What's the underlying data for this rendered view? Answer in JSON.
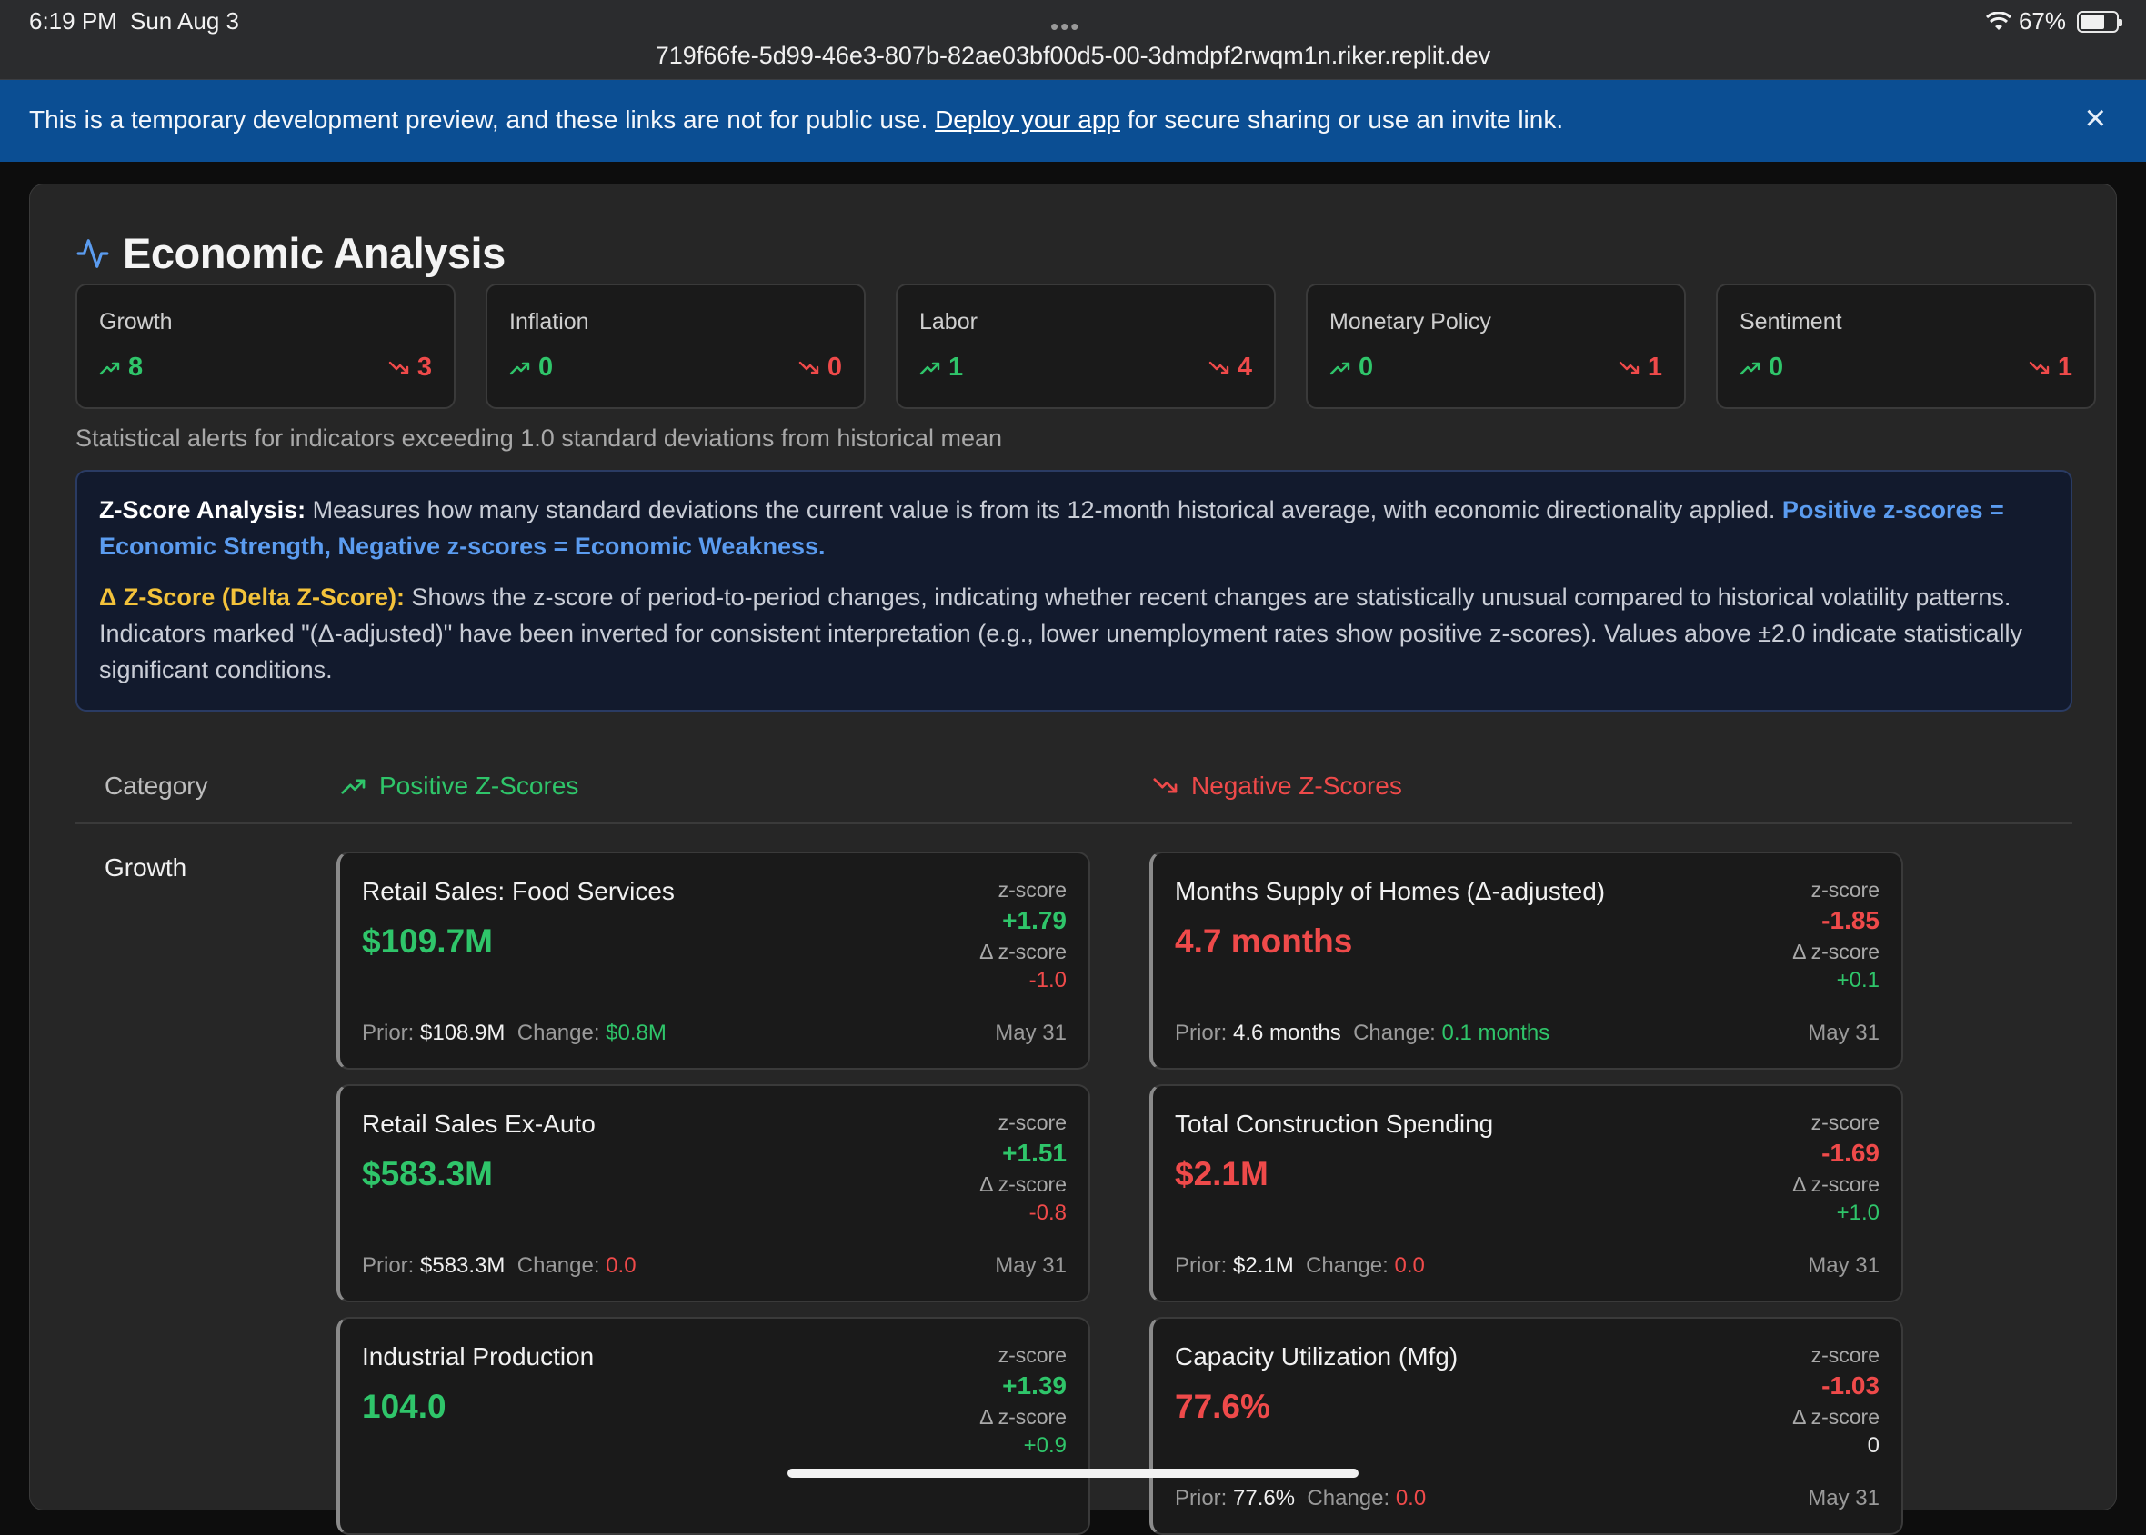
{
  "status": {
    "time": "6:19 PM",
    "date": "Sun Aug 3",
    "dots": "•••",
    "url": "719f66fe-5d99-46e3-807b-82ae03bf00d5-00-3dmdpf2rwqm1n.riker.replit.dev",
    "battery": "67%"
  },
  "banner": {
    "text_before": "This is a temporary development preview, and these links are not for public use. ",
    "link": "Deploy your app",
    "text_after": " for secure sharing or use an invite link.",
    "close": "×"
  },
  "page": {
    "title": "Economic Analysis",
    "subtitle": "Statistical alerts for indicators exceeding 1.0 standard deviations from historical mean"
  },
  "categories": [
    {
      "name": "Growth",
      "pos": "8",
      "neg": "3"
    },
    {
      "name": "Inflation",
      "pos": "0",
      "neg": "0"
    },
    {
      "name": "Labor",
      "pos": "1",
      "neg": "4"
    },
    {
      "name": "Monetary Policy",
      "pos": "0",
      "neg": "1"
    },
    {
      "name": "Sentiment",
      "pos": "0",
      "neg": "1"
    }
  ],
  "info": {
    "z_label": "Z-Score Analysis:",
    "z_text": " Measures how many standard deviations the current value is from its 12-month historical average, with economic directionality applied. ",
    "z_highlight": "Positive z-scores = Economic Strength, Negative z-scores = Economic Weakness.",
    "d_label": "Δ Z-Score (Delta Z-Score):",
    "d_text": " Shows the z-score of period-to-period changes, indicating whether recent changes are statistically unusual compared to historical volatility patterns. Indicators marked \"(Δ-adjusted)\" have been inverted for consistent interpretation (e.g., lower unemployment rates show positive z-scores). Values above ±2.0 indicate statistically significant conditions."
  },
  "table": {
    "col_category": "Category",
    "col_positive": "Positive Z-Scores",
    "col_negative": "Negative Z-Scores",
    "row_label": "Growth"
  },
  "labels": {
    "zscore": "z-score",
    "dzscore": "Δ z-score",
    "prior": "Prior: ",
    "change": "Change: "
  },
  "positive": [
    {
      "name": "Retail Sales: Food Services",
      "value": "$109.7M",
      "z": "+1.79",
      "dz": "-1.0",
      "prior": "$108.9M",
      "change": "$0.8M",
      "date": "May 31"
    },
    {
      "name": "Retail Sales Ex-Auto",
      "value": "$583.3M",
      "z": "+1.51",
      "dz": "-0.8",
      "prior": "$583.3M",
      "change": "0.0",
      "date": "May 31"
    },
    {
      "name": "Industrial Production",
      "value": "104.0",
      "z": "+1.39",
      "dz": "+0.9",
      "prior": "",
      "change": "",
      "date": ""
    }
  ],
  "negative": [
    {
      "name": "Months Supply of Homes (Δ-adjusted)",
      "value": "4.7 months",
      "z": "-1.85",
      "dz": "+0.1",
      "prior": "4.6 months",
      "change": "0.1 months",
      "date": "May 31"
    },
    {
      "name": "Total Construction Spending",
      "value": "$2.1M",
      "z": "-1.69",
      "dz": "+1.0",
      "prior": "$2.1M",
      "change": "0.0",
      "date": "May 31"
    },
    {
      "name": "Capacity Utilization (Mfg)",
      "value": "77.6%",
      "z": "-1.03",
      "dz": "0",
      "prior": "77.6%",
      "change": "0.0",
      "date": "May 31"
    }
  ],
  "colors": {
    "positive": "#2fc56a",
    "negative": "#ef4a4a",
    "banner": "#0b4e93",
    "accent_blue": "#5b9cf0",
    "accent_yellow": "#f3c23b"
  }
}
